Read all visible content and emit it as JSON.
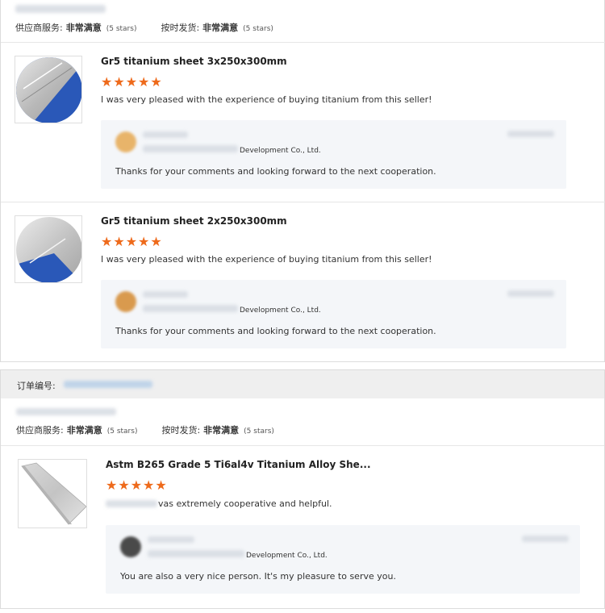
{
  "ratings": {
    "service_label": "供应商服务:",
    "service_value": "非常满意",
    "service_count": "(5 stars)",
    "shipping_label": "按时发货:",
    "shipping_value": "非常满意",
    "shipping_count": "(5 stars)"
  },
  "reviews": [
    {
      "title": "Gr5 titanium sheet 3x250x300mm",
      "stars": 5,
      "text": "I was very pleased with the experience of buying titanium from this seller!",
      "reply_company": "Development Co., Ltd.",
      "reply_text": "Thanks for your comments and looking forward to the next cooperation."
    },
    {
      "title": "Gr5 titanium sheet 2x250x300mm",
      "stars": 5,
      "text": "I was very pleased with the experience of buying titanium from this seller!",
      "reply_company": "Development Co., Ltd.",
      "reply_text": "Thanks for your comments and looking forward to the next cooperation."
    }
  ],
  "order": {
    "label": "订单编号:",
    "review": {
      "title": "Astm B265 Grade 5 Ti6al4v Titanium Alloy She...",
      "stars": 5,
      "text": "vas extremely cooperative and helpful.",
      "reply_company": "Development Co., Ltd.",
      "reply_text": "You are also a very nice person. It's my pleasure to serve you."
    }
  },
  "colors": {
    "star": "#ee6a1b",
    "reply_bg": "#f4f6f9",
    "order_header_bg": "#efefef"
  },
  "icons": {
    "star": "star-icon"
  }
}
